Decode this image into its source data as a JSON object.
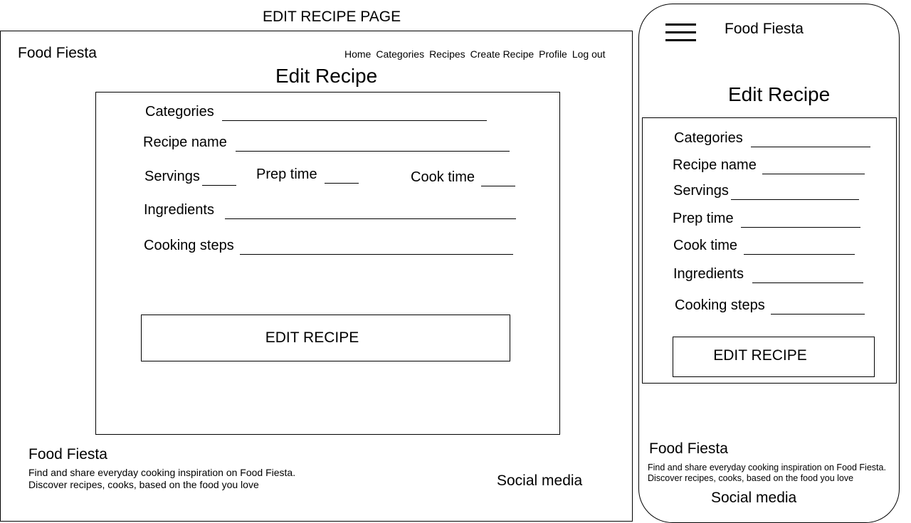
{
  "page_heading": "EDIT RECIPE PAGE",
  "desktop": {
    "brand": "Food Fiesta",
    "nav": [
      "Home",
      "Categories",
      "Recipes",
      "Create Recipe",
      "Profile",
      "Log out"
    ],
    "title": "Edit Recipe",
    "fields": {
      "categories": "Categories",
      "recipe_name": "Recipe name",
      "servings": "Servings",
      "prep_time": "Prep time",
      "cook_time": "Cook time",
      "ingredients": "Ingredients",
      "cooking_steps": "Cooking steps"
    },
    "submit_label": "EDIT RECIPE",
    "footer": {
      "brand": "Food Fiesta",
      "line1": "Find and share everyday cooking inspiration on Food Fiesta.",
      "line2": "Discover recipes, cooks, based on the food you love",
      "social": "Social media"
    }
  },
  "mobile": {
    "brand": "Food Fiesta",
    "title": "Edit Recipe",
    "fields": {
      "categories": "Categories",
      "recipe_name": "Recipe name",
      "servings": "Servings",
      "prep_time": "Prep time",
      "cook_time": "Cook time",
      "ingredients": "Ingredients",
      "cooking_steps": "Cooking steps"
    },
    "submit_label": "EDIT RECIPE",
    "footer": {
      "brand": "Food Fiesta",
      "line1": "Find and share everyday cooking inspiration on Food Fiesta.",
      "line2": "Discover recipes, cooks, based on the food you love",
      "social": "Social media"
    }
  },
  "icons": {
    "menu": "hamburger-menu-icon"
  }
}
